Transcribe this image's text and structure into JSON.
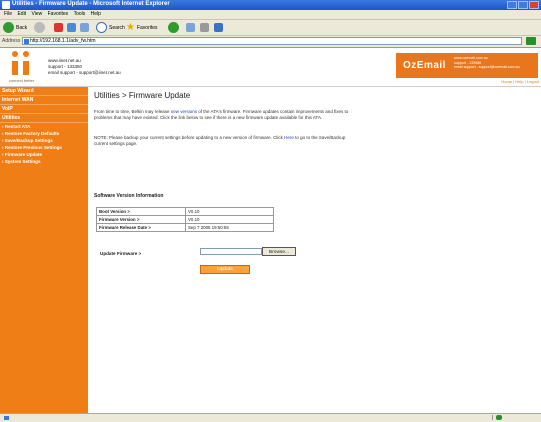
{
  "window": {
    "title": "Utilities - Firmware Update - Microsoft Internet Explorer"
  },
  "menu": [
    "File",
    "Edit",
    "View",
    "Favorites",
    "Tools",
    "Help"
  ],
  "toolbar": {
    "back_label": "Back",
    "search_label": "Search",
    "favorites_label": "Favorites"
  },
  "address": {
    "label": "Address",
    "url": "http://192.168.1.1/adv_fw.htm"
  },
  "header": {
    "logo_tagline": "connect better",
    "contact_web": "www.iinet.net.au",
    "contact_support": "support - 133350",
    "contact_email": "email support - support@iinet.net.au",
    "brand": "OzEmail",
    "brand_web": "www.ozemail.com.au",
    "brand_support": "support - 133986",
    "brand_email": "email support - support@ozemail.com.au",
    "links": "Home | Help | Logout"
  },
  "sidebar": {
    "items": [
      {
        "label": "Setup Wizard",
        "sub": false
      },
      {
        "label": "Internet WAN",
        "sub": false
      },
      {
        "label": "VoIP",
        "sub": false
      },
      {
        "label": "Utilities",
        "sub": false
      },
      {
        "label": "› Restart ATA",
        "sub": true
      },
      {
        "label": "› Restore Factory Defaults",
        "sub": true
      },
      {
        "label": "› Save/Backup Settings",
        "sub": true
      },
      {
        "label": "› Restore Previous Settings",
        "sub": true
      },
      {
        "label": "› Firmware Update",
        "sub": true
      },
      {
        "label": "› System Settings",
        "sub": true
      }
    ]
  },
  "main": {
    "title": "Utilities > Firmware Update",
    "intro_a": "From time to time, Belkin may release ",
    "intro_link": "new versions",
    "intro_b": " of the ATA's firmware. Firmware updates contain improvements and fixes to problems that may have existed. Click the link below to see if there is a new firmware update available for this ATA.",
    "note_a": "NOTE: Please backup your current settings before updating to a new version of firmware. Click ",
    "note_link": "Here",
    "note_b": " to go to the Save/Backup current settings page.",
    "section_title": "Software Version Information",
    "versions": [
      {
        "key": "Boot Version >",
        "value": "V0.10"
      },
      {
        "key": "Firmware Version >",
        "value": "V0.10"
      },
      {
        "key": "Firmware Release Date >",
        "value": "Sep 7 2005 19:50:55"
      }
    ],
    "update_label": "Update Firmware >",
    "browse_label": "Browse...",
    "update_button": "Update"
  },
  "colors": {
    "accent": "#f07e16",
    "oz": "#e8761c"
  }
}
